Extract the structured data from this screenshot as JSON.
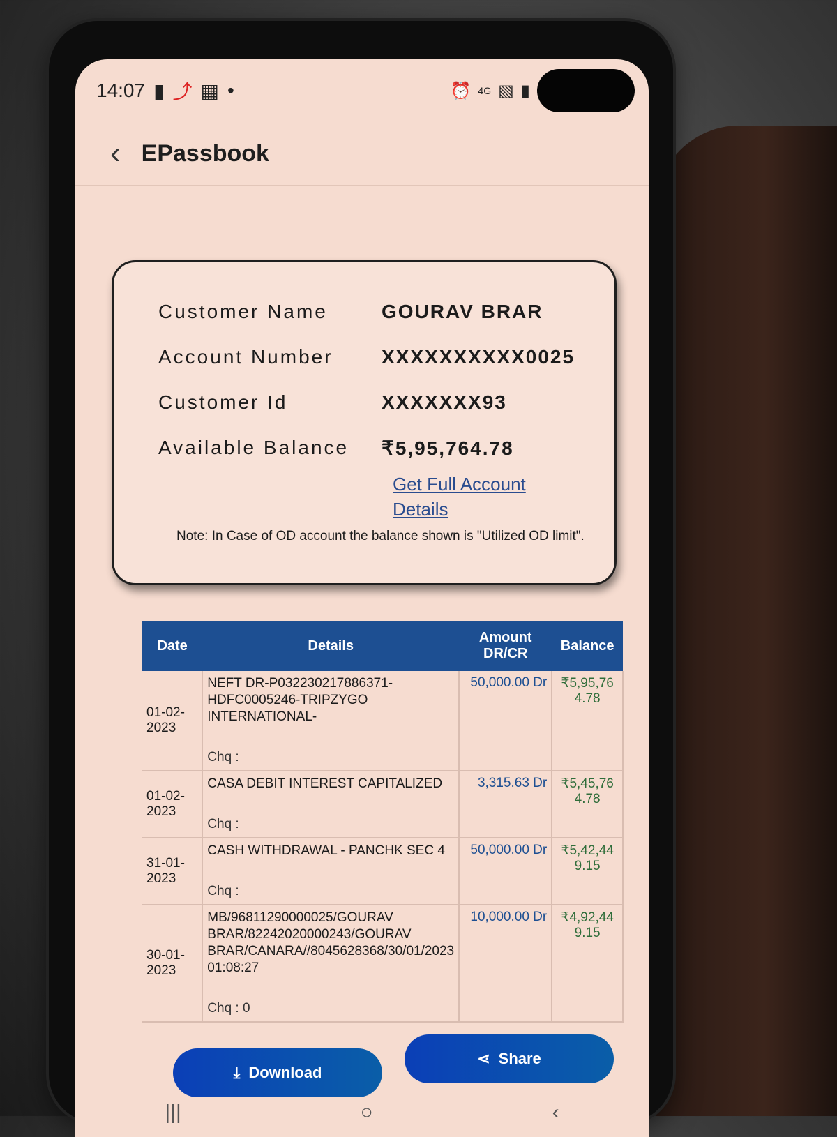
{
  "status_bar": {
    "time": "14:07",
    "network": "4G",
    "icons": [
      "chat-icon",
      "airtel-icon",
      "calendar-icon",
      "dot-icon",
      "alarm-icon",
      "signal-icon",
      "battery-icon"
    ]
  },
  "app_bar": {
    "back_icon": "‹",
    "title": "EPassbook"
  },
  "account": {
    "labels": {
      "customer_name": "Customer Name",
      "account_number": "Account Number",
      "customer_id": "Customer Id",
      "available_balance": "Available Balance"
    },
    "values": {
      "customer_name": "GOURAV BRAR",
      "account_number": "XXXXXXXXXX0025",
      "customer_id": "XXXXXXX93",
      "available_balance": "₹5,95,764.78"
    },
    "link": "Get Full Account Details",
    "note": "Note: In Case of OD account the balance shown is \"Utilized OD limit\"."
  },
  "table": {
    "headers": [
      "Date",
      "Details",
      "Amount DR/CR",
      "Balance"
    ],
    "rows": [
      {
        "date": "01-02-2023",
        "details": "NEFT DR-P032230217886371-HDFC0005246-TRIPZYGO INTERNATIONAL-",
        "chq": "Chq :",
        "amount": "50,000.00  Dr",
        "balance": "₹5,95,764.78"
      },
      {
        "date": "01-02-2023",
        "details": "CASA DEBIT INTEREST CAPITALIZED",
        "chq": "Chq :",
        "amount": "3,315.63  Dr",
        "balance": "₹5,45,764.78"
      },
      {
        "date": "31-01-2023",
        "details": "CASH WITHDRAWAL - PANCHK SEC 4",
        "chq": "Chq :",
        "amount": "50,000.00  Dr",
        "balance": "₹5,42,449.15"
      },
      {
        "date": "30-01-2023",
        "details": "MB/96811290000025/GOURAV BRAR/82242020000243/GOURAV BRAR/CANARA//8045628368/30/01/2023 01:08:27",
        "chq": "Chq : 0",
        "amount": "10,000.00  Dr",
        "balance": "₹4,92,449.15"
      }
    ]
  },
  "buttons": {
    "download": "Download",
    "share": "Share"
  },
  "nav": {
    "recents": "|||",
    "home": "○",
    "back": "‹"
  }
}
